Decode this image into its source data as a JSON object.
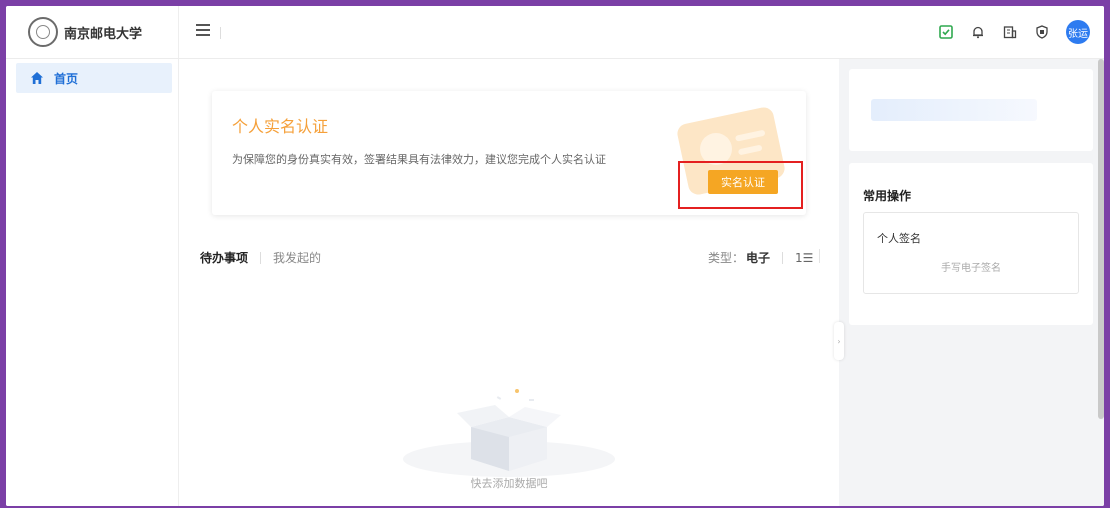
{
  "header": {
    "logo_text": "南京邮电大学",
    "avatar_text": "张运",
    "icons": [
      "task-icon",
      "bell-icon",
      "building-icon",
      "shield-icon"
    ]
  },
  "sidebar": {
    "items": [
      {
        "label": "首页",
        "icon": "home-icon"
      }
    ]
  },
  "main": {
    "card": {
      "title": "个人实名认证",
      "description": "为保障您的身份真实有效，签署结果具有法律效力，建议您完成个人实名认证",
      "button_label": "实名认证"
    },
    "tabs": [
      {
        "label": "待办事项",
        "active": true
      },
      {
        "label": "我发起的",
        "active": false
      }
    ],
    "filter": {
      "label": "类型：",
      "value": "电子"
    },
    "empty_text": "快去添加数据吧"
  },
  "right_panel": {
    "common_ops_title": "常用操作",
    "op": {
      "title": "个人签名",
      "subtitle": "手写电子签名"
    }
  },
  "colors": {
    "accent": "#f5a623",
    "primary": "#1f6fd6",
    "highlight": "#e42020",
    "frame": "#7b3fa6"
  }
}
